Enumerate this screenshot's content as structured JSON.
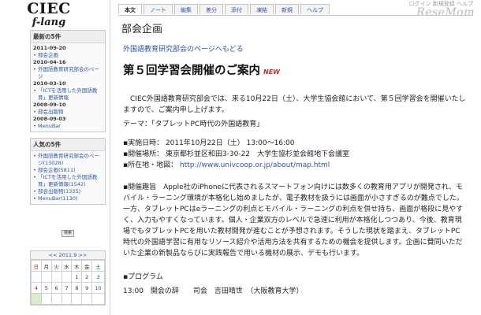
{
  "logo": {
    "line1": "CIEC",
    "line2": "f-lang"
  },
  "watermark": "ReseMom",
  "topright": "ログイン  新規登録  ヘルプ",
  "tabs": [
    "本文",
    "ノート",
    "編集",
    "差分",
    "添付",
    "凍結",
    "新規",
    "ヘルプ"
  ],
  "recent": {
    "title": "最新の5件",
    "entries": [
      {
        "date": "2011-09-20",
        "link": "部会企画"
      },
      {
        "date": "2010-04-16",
        "link": "外国語教育研究部会のページ"
      },
      {
        "date": "2010-03-10",
        "link": "「ICTを活用した外国語教育」更新情報"
      },
      {
        "date": "2008-09-10",
        "link": "部会出版物"
      },
      {
        "date": "2008-09-03",
        "link": "MenuBar"
      }
    ]
  },
  "popular": {
    "title": "人気の5件",
    "items": [
      "外国語教育研究部会のページ(13028)",
      "部会企画(5811)",
      "「ICTを活用した外国語教育」更新情報(1542)",
      "部会出版物(1335)",
      "MenuBar(1130)"
    ]
  },
  "search_label": "検索",
  "calendar": {
    "header": "<< 2011.9 >>",
    "weekdays": [
      "日",
      "月",
      "火",
      "水",
      "木",
      "金",
      "土"
    ],
    "rows": [
      [
        "",
        "",
        "",
        "",
        "1",
        "2",
        "3"
      ],
      [
        "4",
        "5",
        "6",
        "7",
        "8",
        "9",
        "10"
      ]
    ]
  },
  "main": {
    "page_title": "部会企画",
    "back_link": "外国語教育研究部会のページへもどる",
    "heading": "第５回学習会開催のご案内",
    "new_badge": "NEW",
    "intro": "　CIEC外国語教育研究部会では、来る10月22日（土）、大学生協会館において、第５回学習会を開催いたしますので、ご案内申し上げます。",
    "theme": "テーマ：「タブレットPC時代の外国語教育」",
    "datetime": "▪実施日時： 2011年10月22日（土） 13:00〜16:00",
    "venue": "▪開催場所： 東京都杉並区和田3-30-22　大学生協杉並会館地下会議室",
    "map_label": "▪所在地・地図：",
    "map_url": "http://www.univcoop.or.jp/about/map.html",
    "purpose": "▪開催趣旨　Apple社のiPhoneに代表されるスマートフォン向けには数多くの教育用アプリが開発され、モバイル・ラーニング環境が本格化し始めましたが、電子教材を扱うには画面が小さすぎるのが難点でした。一方、タブレットPCはeラーニングの利点とモバイル・ラーニングの利点を併せ持ち、画面が格段に見やすく、入力もやすくなっています。個人・企業双方のレベルで急速に利用が本格化しつつあり、今後、教育現場でもタブレットPCを用いた教材開発が進むことが予想されます。そうした現状を踏まえ、タブレットPC時代の外国語学習に有用なリソース紹介や活用方法を共有するための機会を提供します。企画に賛同いただいた企業の新製品ならびに実践報告で用いる機材の展示、デモも行います。",
    "program_label": "▪プログラム",
    "program_first": "13:00　開会の辞　　司会　吉田晴世　（大阪教育大学）"
  }
}
